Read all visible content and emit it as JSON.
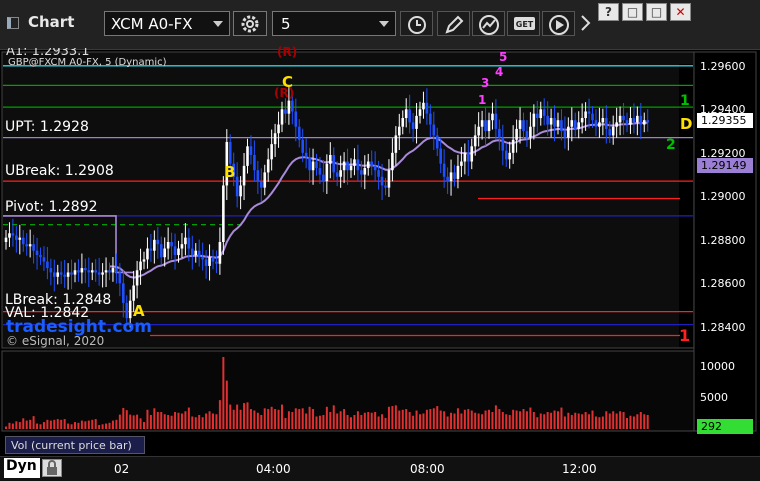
{
  "titlebar": {
    "title": "Chart",
    "symbol": "XCM A0-FX",
    "interval": "5",
    "window_buttons": [
      "?",
      "□",
      "□",
      "✕"
    ]
  },
  "legend": {
    "cut_off_text": "A1: 1.2933.1",
    "instrument": "GBP@FXCM A0-FX, 5 (Dynamic)"
  },
  "levels": {
    "upt": "UPT: 1.2928",
    "ubreak": "UBreak: 1.2908",
    "pivot": "Pivot: 1.2892",
    "lbreak": "LBreak: 1.2848",
    "val": "VAL: 1.2842"
  },
  "watermark": {
    "site": "tradesight.com",
    "copyright": "© eSignal, 2020"
  },
  "price_tags": {
    "last": "1.29355",
    "ma": "1.29149",
    "volume": "292"
  },
  "volume_panel": {
    "label": "Vol (current price bar)",
    "ticks": [
      "10000",
      "5000"
    ]
  },
  "bottom": {
    "dyn_label": "Dyn",
    "day_label": "02"
  },
  "colors": {
    "background": "#000000",
    "up_candle": "#ffffff",
    "down_candle": "#1e50ff",
    "moving_average": "#a88ad8",
    "green_level": "#00a000",
    "red_level": "#ff2020",
    "blue_level": "#2020c0",
    "cyan_level": "#30d0e0",
    "purple_level": "#9b7fd4",
    "volume_bars": "#e03030"
  },
  "chart_data": {
    "type": "candlestick",
    "instrument": "GBP@FXCM A0-FX",
    "interval_minutes": 5,
    "x_ticks": [
      "04:00",
      "08:00",
      "12:00"
    ],
    "y_ticks": [
      1.284,
      1.286,
      1.288,
      1.29,
      1.292,
      1.294,
      1.296
    ],
    "ylim": [
      1.2835,
      1.2966
    ],
    "volume_ticks": [
      5000,
      10000
    ],
    "labeled_levels": [
      {
        "name": "UPT",
        "value": 1.2928
      },
      {
        "name": "UBreak",
        "value": 1.2908
      },
      {
        "name": "Pivot",
        "value": 1.2892
      },
      {
        "name": "LBreak",
        "value": 1.2848
      },
      {
        "name": "VAL",
        "value": 1.2842
      }
    ],
    "last_price": 1.29355,
    "ma_value": 1.29149,
    "last_volume": 292,
    "close_series": [
      1.2882,
      1.2884,
      1.2883,
      1.2881,
      1.2882,
      1.2879,
      1.2878,
      1.2879,
      1.2876,
      1.2874,
      1.2873,
      1.2871,
      1.2868,
      1.2866,
      1.2864,
      1.2866,
      1.2865,
      1.2864,
      1.2866,
      1.2865,
      1.2867,
      1.2866,
      1.2868,
      1.2867,
      1.2866,
      1.2867,
      1.2866,
      1.2865,
      1.2866,
      1.2867,
      1.2866,
      1.2868,
      1.2866,
      1.2861,
      1.2852,
      1.2845,
      1.2853,
      1.286,
      1.2867,
      1.2871,
      1.2872,
      1.2877,
      1.2876,
      1.2881,
      1.2879,
      1.2873,
      1.2877,
      1.288,
      1.2878,
      1.2874,
      1.2877,
      1.2879,
      1.2882,
      1.2877,
      1.2874,
      1.2876,
      1.2873,
      1.2872,
      1.2869,
      1.2873,
      1.2871,
      1.287,
      1.288,
      1.2906,
      1.2926,
      1.2916,
      1.291,
      1.2901,
      1.2906,
      1.2915,
      1.2924,
      1.292,
      1.2913,
      1.2908,
      1.2905,
      1.2912,
      1.2918,
      1.2925,
      1.293,
      1.2934,
      1.2941,
      1.2939,
      1.2945,
      1.294,
      1.2933,
      1.2927,
      1.2921,
      1.2919,
      1.2913,
      1.2917,
      1.2914,
      1.2911,
      1.2908,
      1.2916,
      1.292,
      1.2912,
      1.291,
      1.2913,
      1.2917,
      1.2913,
      1.2915,
      1.2918,
      1.2913,
      1.2911,
      1.2914,
      1.2917,
      1.2915,
      1.2913,
      1.291,
      1.2906,
      1.2905,
      1.2913,
      1.2921,
      1.2929,
      1.2933,
      1.2937,
      1.2941,
      1.2935,
      1.2932,
      1.2938,
      1.2941,
      1.2944,
      1.2939,
      1.2934,
      1.2929,
      1.2923,
      1.2916,
      1.291,
      1.2908,
      1.2912,
      1.2909,
      1.2915,
      1.2917,
      1.2921,
      1.2917,
      1.2924,
      1.2929,
      1.2933,
      1.2936,
      1.2931,
      1.2936,
      1.2939,
      1.2932,
      1.2928,
      1.2922,
      1.2918,
      1.2921,
      1.2927,
      1.2932,
      1.2936,
      1.2931,
      1.2928,
      1.2933,
      1.2939,
      1.2937,
      1.2941,
      1.2938,
      1.2934,
      1.2937,
      1.2933,
      1.2936,
      1.2931,
      1.2928,
      1.2933,
      1.2936,
      1.2932,
      1.2935,
      1.2937,
      1.294,
      1.2939,
      1.2936,
      1.2933,
      1.2935,
      1.2937,
      1.2932,
      1.2929,
      1.2933,
      1.2935,
      1.2938,
      1.2936,
      1.2934,
      1.2937,
      1.2935,
      1.2938,
      1.2934,
      1.2936,
      1.2935
    ]
  }
}
